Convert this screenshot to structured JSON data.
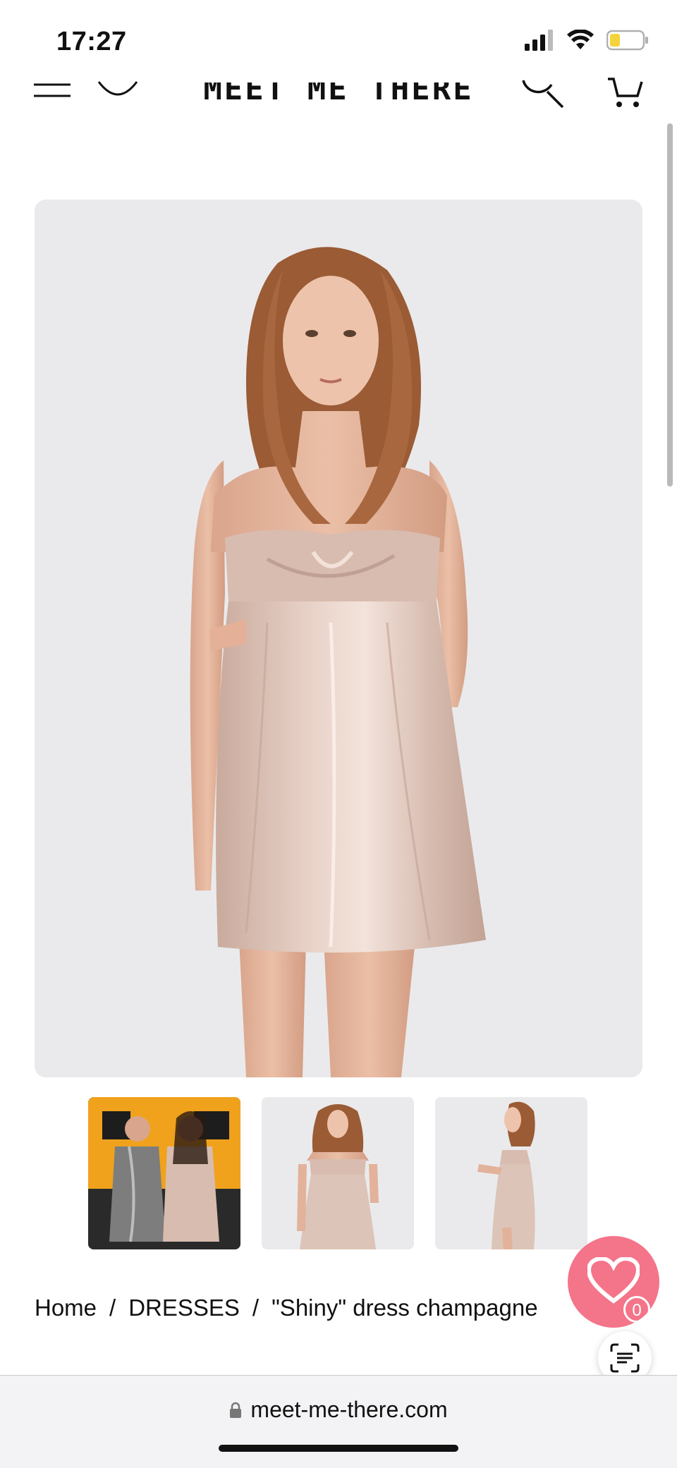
{
  "status_bar": {
    "time": "17:27",
    "battery_color": "#f5d33b"
  },
  "header": {
    "logo_text": "MEET ME THERE",
    "icons": [
      "menu-icon",
      "chevron-down-icon",
      "search-icon",
      "cart-icon"
    ]
  },
  "product": {
    "main_image": "model-shiny-dress-champagne-front",
    "thumbnails": [
      {
        "name": "thumb-lifestyle-school-bus"
      },
      {
        "name": "thumb-front-view"
      },
      {
        "name": "thumb-side-view"
      }
    ]
  },
  "breadcrumb": {
    "items": [
      "Home",
      "DRESSES",
      "\"Shiny\" dress champagne"
    ],
    "separator": "/"
  },
  "wishlist": {
    "count": "0",
    "color": "#f4748a"
  },
  "browser": {
    "url": "meet-me-there.com"
  },
  "colors": {
    "accent": "#f4748a",
    "image_bg": "#eaeaec",
    "dress": "#d9bfb4"
  }
}
